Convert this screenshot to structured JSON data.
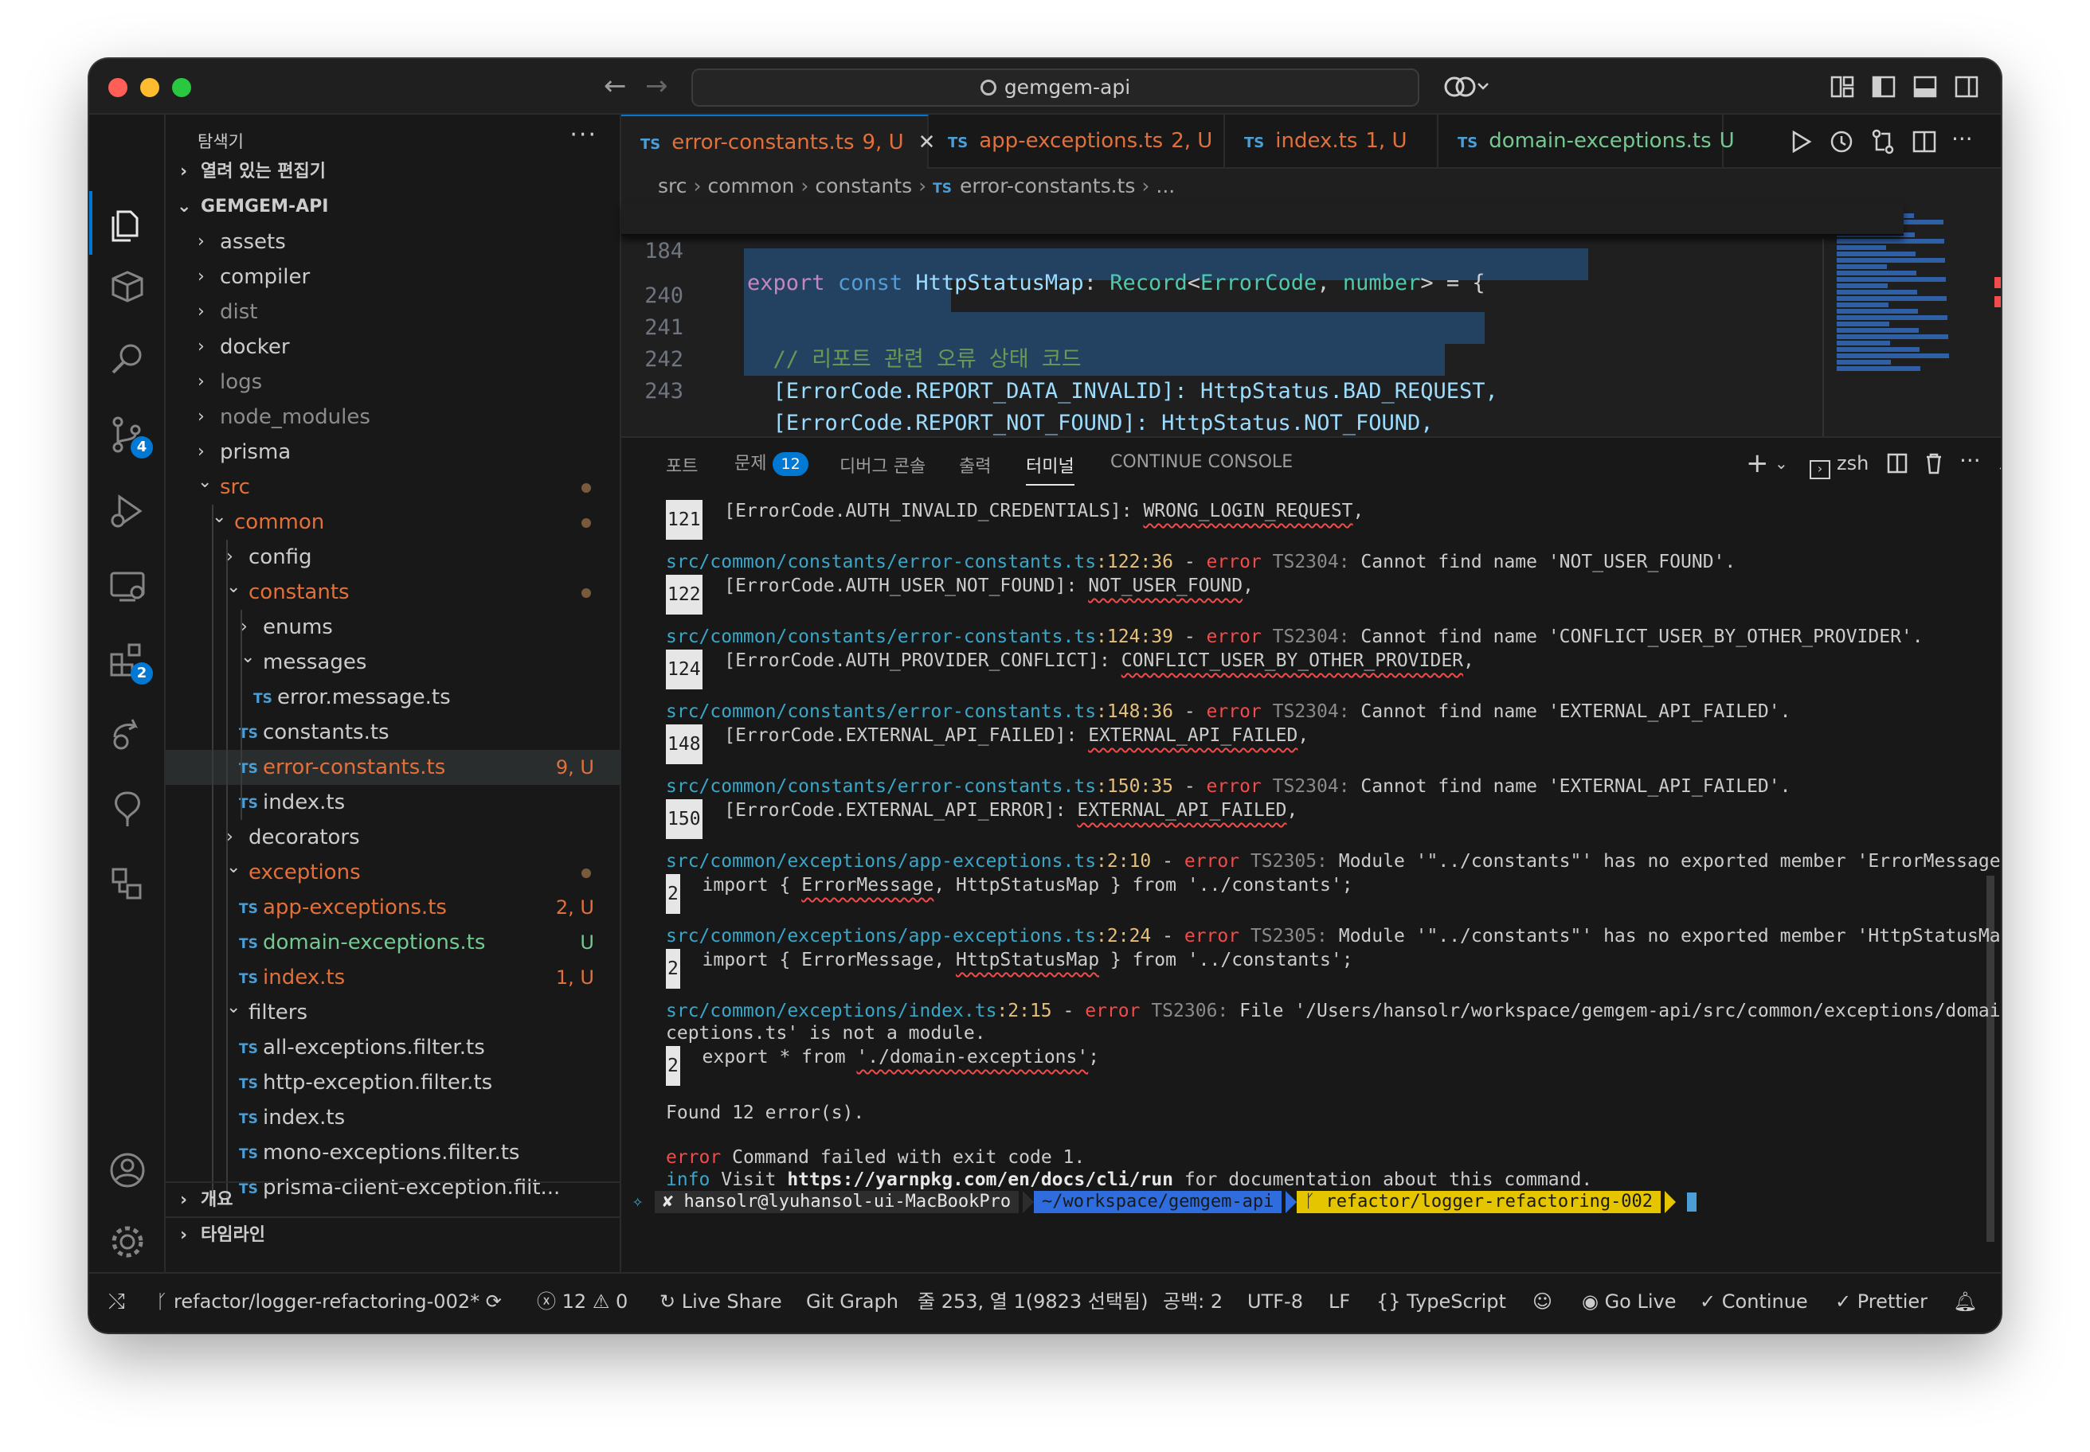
{
  "window": {
    "search_label": "gemgem-api"
  },
  "colors": {
    "accent": "#0078d4",
    "modified": "#e2703a",
    "untracked": "#73c991",
    "error": "#f14c4c",
    "path": "#3aa7c9"
  },
  "sidebar": {
    "header": "탐색기",
    "open_editors": "열려 있는 편집기",
    "root": "GEMGEM-API",
    "outline": "개요",
    "timeline": "타임라인",
    "tree": [
      {
        "label": "assets",
        "kind": "folder",
        "state": "collapsed",
        "depth": 1
      },
      {
        "label": "compiler",
        "kind": "folder",
        "state": "collapsed",
        "depth": 1
      },
      {
        "label": "dist",
        "kind": "folder",
        "state": "collapsed",
        "depth": 1,
        "dim": true
      },
      {
        "label": "docker",
        "kind": "folder",
        "state": "collapsed",
        "depth": 1
      },
      {
        "label": "logs",
        "kind": "folder",
        "state": "collapsed",
        "depth": 1,
        "dim": true
      },
      {
        "label": "node_modules",
        "kind": "folder",
        "state": "collapsed",
        "depth": 1,
        "dim": true
      },
      {
        "label": "prisma",
        "kind": "folder",
        "state": "collapsed",
        "depth": 1
      },
      {
        "label": "src",
        "kind": "folder",
        "state": "expanded",
        "depth": 1,
        "status": "modified"
      },
      {
        "label": "common",
        "kind": "folder",
        "state": "expanded",
        "depth": 2,
        "status": "modified"
      },
      {
        "label": "config",
        "kind": "folder",
        "state": "collapsed",
        "depth": 3
      },
      {
        "label": "constants",
        "kind": "folder",
        "state": "expanded",
        "depth": 3,
        "status": "modified"
      },
      {
        "label": "enums",
        "kind": "folder",
        "state": "collapsed",
        "depth": 4
      },
      {
        "label": "messages",
        "kind": "folder",
        "state": "expanded",
        "depth": 4
      },
      {
        "label": "error.message.ts",
        "kind": "file",
        "depth": 5
      },
      {
        "label": "constants.ts",
        "kind": "file",
        "depth": 4
      },
      {
        "label": "error-constants.ts",
        "kind": "file",
        "depth": 4,
        "status": "modified",
        "badge": "9, U",
        "selected": true
      },
      {
        "label": "index.ts",
        "kind": "file",
        "depth": 4
      },
      {
        "label": "decorators",
        "kind": "folder",
        "state": "collapsed",
        "depth": 3
      },
      {
        "label": "exceptions",
        "kind": "folder",
        "state": "expanded",
        "depth": 3,
        "status": "modified"
      },
      {
        "label": "app-exceptions.ts",
        "kind": "file",
        "depth": 4,
        "status": "modified",
        "badge": "2, U"
      },
      {
        "label": "domain-exceptions.ts",
        "kind": "file",
        "depth": 4,
        "status": "untracked",
        "badge": "U"
      },
      {
        "label": "index.ts",
        "kind": "file",
        "depth": 4,
        "status": "modified",
        "badge": "1, U"
      },
      {
        "label": "filters",
        "kind": "folder",
        "state": "expanded",
        "depth": 3
      },
      {
        "label": "all-exceptions.filter.ts",
        "kind": "file",
        "depth": 4
      },
      {
        "label": "http-exception.filter.ts",
        "kind": "file",
        "depth": 4
      },
      {
        "label": "index.ts",
        "kind": "file",
        "depth": 4
      },
      {
        "label": "mono-exceptions.filter.ts",
        "kind": "file",
        "depth": 4
      },
      {
        "label": "prisma-client-exception.filt...",
        "kind": "file",
        "depth": 4
      }
    ]
  },
  "activity": {
    "scm_badge": "4",
    "extensions_badge": "2"
  },
  "tabs": [
    {
      "name": "error-constants.ts",
      "badge": "9, U",
      "status": "modified",
      "active": true
    },
    {
      "name": "app-exceptions.ts",
      "badge": "2, U",
      "status": "modified"
    },
    {
      "name": "index.ts",
      "badge": "1, U",
      "status": "modified"
    },
    {
      "name": "domain-exceptions.ts",
      "badge": "U",
      "status": "untracked"
    }
  ],
  "tab_type_label": "TS",
  "breadcrumb": [
    "src",
    "common",
    "constants",
    "error-constants.ts",
    "..."
  ],
  "code": {
    "sticky": {
      "num": "184",
      "text": "export const HttpStatusMap: Record<ErrorCode, number> = {"
    },
    "lines": [
      {
        "num": "240",
        "text": ""
      },
      {
        "num": "241",
        "text": "  // 리포트 관련 오류 상태 코드"
      },
      {
        "num": "242",
        "text": "  [ErrorCode.REPORT_DATA_INVALID]: HttpStatus.BAD_REQUEST,"
      },
      {
        "num": "243",
        "text": "  [ErrorCode.REPORT_NOT_FOUND]: HttpStatus.NOT_FOUND,"
      }
    ]
  },
  "panel": {
    "tabs": [
      "포트",
      "문제",
      "디버그 콘솔",
      "출력",
      "터미널",
      "CONTINUE CONSOLE"
    ],
    "problems_count": "12",
    "shell": "zsh"
  },
  "terminal": {
    "blocks": [
      {
        "gutter": "121",
        "code": "[ErrorCode.AUTH_INVALID_CREDENTIALS]: ",
        "squig": "WRONG_LOGIN_REQUEST",
        "tail": ","
      },
      {
        "path": "src/common/constants/error-constants.ts",
        "loc": ":122:36",
        "err": "error",
        "tscode": "TS2304:",
        "msg": " Cannot find name 'NOT_USER_FOUND'."
      },
      {
        "gutter": "122",
        "code": "[ErrorCode.AUTH_USER_NOT_FOUND]: ",
        "squig": "NOT_USER_FOUND",
        "tail": ","
      },
      {
        "path": "src/common/constants/error-constants.ts",
        "loc": ":124:39",
        "err": "error",
        "tscode": "TS2304:",
        "msg": " Cannot find name 'CONFLICT_USER_BY_OTHER_PROVIDER'."
      },
      {
        "gutter": "124",
        "code": "[ErrorCode.AUTH_PROVIDER_CONFLICT]: ",
        "squig": "CONFLICT_USER_BY_OTHER_PROVIDER",
        "tail": ","
      },
      {
        "path": "src/common/constants/error-constants.ts",
        "loc": ":148:36",
        "err": "error",
        "tscode": "TS2304:",
        "msg": " Cannot find name 'EXTERNAL_API_FAILED'."
      },
      {
        "gutter": "148",
        "code": "[ErrorCode.EXTERNAL_API_FAILED]: ",
        "squig": "EXTERNAL_API_FAILED",
        "tail": ","
      },
      {
        "path": "src/common/constants/error-constants.ts",
        "loc": ":150:35",
        "err": "error",
        "tscode": "TS2304:",
        "msg": " Cannot find name 'EXTERNAL_API_FAILED'."
      },
      {
        "gutter": "150",
        "code": "[ErrorCode.EXTERNAL_API_ERROR]: ",
        "squig": "EXTERNAL_API_FAILED",
        "tail": ","
      },
      {
        "path": "src/common/exceptions/app-exceptions.ts",
        "loc": ":2:10",
        "err": "error",
        "tscode": "TS2305:",
        "msg": " Module '\"../constants\"' has no exported member 'ErrorMessage'."
      },
      {
        "gutter": "2",
        "code": "import { ",
        "squig": "ErrorMessage",
        "tail": ", HttpStatusMap } from '../constants';"
      },
      {
        "path": "src/common/exceptions/app-exceptions.ts",
        "loc": ":2:24",
        "err": "error",
        "tscode": "TS2305:",
        "msg": " Module '\"../constants\"' has no exported member 'HttpStatusMap'."
      },
      {
        "gutter": "2",
        "code": "import { ErrorMessage, ",
        "squig": "HttpStatusMap",
        "tail": " } from '../constants';"
      },
      {
        "path": "src/common/exceptions/index.ts",
        "loc": ":2:15",
        "err": "error",
        "tscode": "TS2306:",
        "msg": " File '/Users/hansolr/workspace/gemgem-api/src/common/exceptions/domain-ex",
        "msg2": "ceptions.ts' is not a module."
      },
      {
        "gutter": "2",
        "code": "export * from ",
        "squig": "'./domain-exceptions'",
        "tail": ";"
      }
    ],
    "found": "Found 12 error(s).",
    "fail_prefix": "error",
    "fail_msg": " Command failed with exit code 1.",
    "info_prefix": "info",
    "info_pre": " Visit ",
    "info_url": "https://yarnpkg.com/en/docs/cli/run",
    "info_post": " for documentation about this command.",
    "prompt_user": "✘ hansolr@lyuhansol-ui-MacBookPro",
    "prompt_dir": "~/workspace/gemgem-api",
    "prompt_branch": "ᚴ refactor/logger-refactoring-002"
  },
  "status": {
    "branch": "refactor/logger-refactoring-002*",
    "errors": "12",
    "warnings": "0",
    "live_share": "Live Share",
    "git_graph": "Git Graph",
    "cursor": "줄 253, 열 1(9823 선택됨)",
    "indent": "공백: 2",
    "encoding": "UTF-8",
    "eol": "LF",
    "language": "TypeScript",
    "go_live": "Go Live",
    "continue": "Continue",
    "prettier": "Prettier"
  }
}
